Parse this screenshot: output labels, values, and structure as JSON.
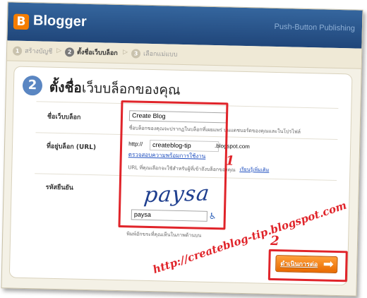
{
  "header": {
    "brand": "Blogger",
    "logo_letter": "B",
    "tagline": "Push-Button Publishing"
  },
  "steps": [
    {
      "num": "1",
      "label": "สร้างบัญชี"
    },
    {
      "num": "2",
      "label": "ตั้งชื่อเว็บบล็อก"
    },
    {
      "num": "3",
      "label": "เลือกแม่แบบ"
    }
  ],
  "page": {
    "step_number": "2",
    "title_bold": "ตั้งชื่อ",
    "title_rest": "เว็บบล็อกของคุณ"
  },
  "form": {
    "blog_title_label": "ชื่อเว็บบล็อก",
    "blog_title_value": "Create Blog",
    "blog_title_hint": "ชื่อบล็อกของคุณจะปรากฏในบล็อกที่เผยแพร่ บนแดชบอร์ดของคุณและในโปรไฟล์",
    "address_label": "ที่อยู่บล็อก (URL)",
    "address_prefix": "http://",
    "address_value": "createblog-tip",
    "address_suffix": ".blogspot.com",
    "check_availability_link": "ตรวจสอบความพร้อมการใช้งาน",
    "address_hint": "URL ที่คุณเลือกจะใช้สำหรับผู้ที่เข้าถึงบล็อกของคุณ",
    "learn_more_link": "เรียนรู้เพิ่มเติม",
    "captcha_label": "รหัสยืนยัน",
    "captcha_image_text": "paysa",
    "captcha_value": "paysa",
    "captcha_hint": "พิมพ์อักขระที่คุณเห็นในภาพด้านบน"
  },
  "continue_button": {
    "label": "ดำเนินการต่อ"
  },
  "annotations": {
    "mark1": "1",
    "mark2": "2",
    "watermark": "http://createblog-tip.blogspot.com"
  },
  "colors": {
    "header_blue": "#20467a",
    "accent_orange": "#f57d00",
    "annotation_red": "#e0242a",
    "link_blue": "#1f4fbf"
  },
  "icons": {
    "captcha_audio": "wheelchair-icon"
  }
}
